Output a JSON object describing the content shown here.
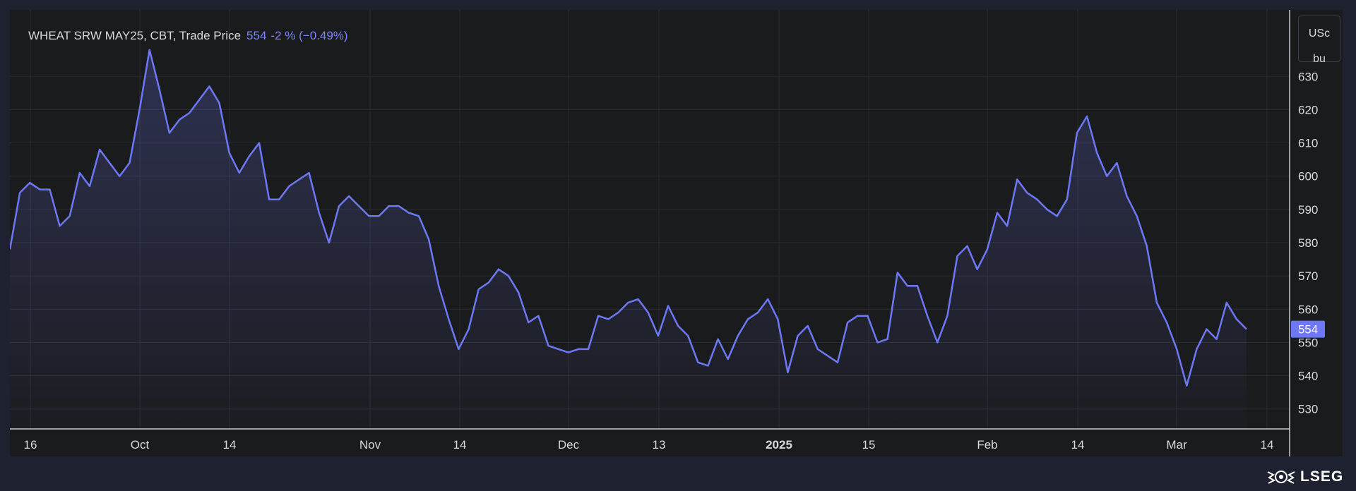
{
  "legend": {
    "instrument": "WHEAT SRW MAY25, CBT, Trade Price",
    "last": "554",
    "change": "-2 % (−0.49%)"
  },
  "unit": {
    "line1": "USc",
    "line2": "bu"
  },
  "brand": "LSEG",
  "colors": {
    "line": "#6e78f7",
    "background": "#1a1b1d",
    "page": "#1e2230",
    "grid": "#2b2d33",
    "price_tag": "#6e78f7"
  },
  "chart_data": {
    "type": "area",
    "title": "WHEAT SRW MAY25, CBT, Trade Price",
    "ylabel": "USc/bu",
    "ylim": [
      524,
      650
    ],
    "grid": true,
    "last_value": 554,
    "y_ticks": [
      530,
      540,
      550,
      560,
      570,
      580,
      590,
      600,
      610,
      620,
      630
    ],
    "x_tick_labels": [
      "16",
      "Oct",
      "14",
      "Nov",
      "14",
      "Dec",
      "13",
      "2025",
      "15",
      "Feb",
      "14",
      "Mar",
      "14"
    ],
    "series": [
      {
        "values": [
          578,
          595,
          598,
          596,
          596,
          585,
          588,
          601,
          597,
          608,
          604,
          600,
          604,
          620,
          638,
          626,
          613,
          617,
          619,
          623,
          627,
          622,
          607,
          601,
          606,
          610,
          593,
          593,
          597,
          599,
          601,
          589,
          580,
          591,
          594,
          591,
          588,
          588,
          591,
          591,
          589,
          588,
          581,
          567,
          557,
          548,
          554,
          566,
          568,
          572,
          570,
          565,
          556,
          558,
          549,
          548,
          547,
          548,
          548,
          558,
          557,
          559,
          562,
          563,
          559,
          552,
          561,
          555,
          552,
          544,
          543,
          551,
          545,
          552,
          557,
          559,
          563,
          557,
          541,
          552,
          555,
          548,
          546,
          544,
          556,
          558,
          558,
          550,
          551,
          571,
          567,
          567,
          558,
          550,
          558,
          576,
          579,
          572,
          578,
          589,
          585,
          599,
          595,
          593,
          590,
          588,
          593,
          613,
          618,
          607,
          600,
          604,
          594,
          588,
          579,
          562,
          556,
          548,
          537,
          548,
          554,
          551,
          562,
          557,
          554
        ]
      }
    ]
  }
}
